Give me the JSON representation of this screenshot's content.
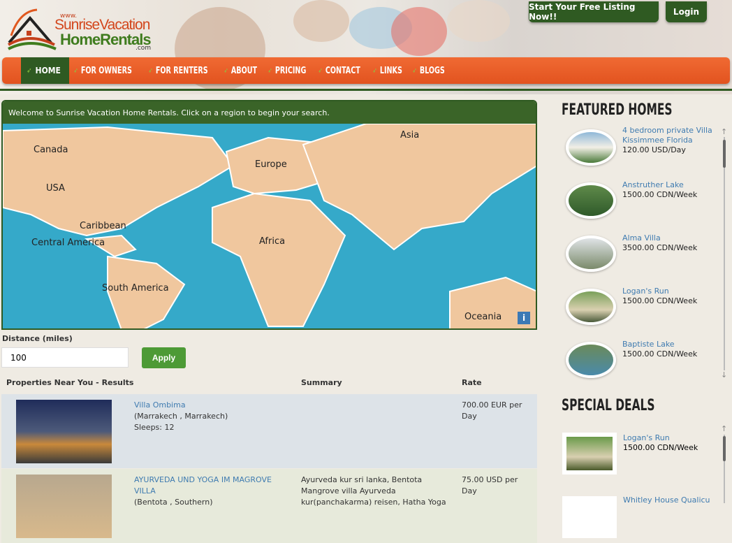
{
  "header": {
    "logo_www": "www.",
    "logo_line1": "SunriseVacation",
    "logo_line2": "HomeRentals",
    "logo_com": ".com",
    "free_listing": "Start Your Free Listing Now!!",
    "login": "Login"
  },
  "nav": [
    "HOME",
    "FOR OWNERS",
    "FOR RENTERS",
    "ABOUT",
    "PRICING",
    "CONTACT",
    "LINKS",
    "BLOGS"
  ],
  "map": {
    "welcome": "Welcome to Sunrise Vacation Home Rentals. Click on a region to begin your search.",
    "regions": [
      "Canada",
      "USA",
      "Caribbean",
      "Central America",
      "South America",
      "Europe",
      "Africa",
      "Asia",
      "Oceania"
    ],
    "info": "i"
  },
  "distance": {
    "label": "Distance (miles)",
    "value": "100",
    "apply": "Apply"
  },
  "results": {
    "headers": [
      "Properties Near You - Results",
      "Summary",
      "Rate"
    ],
    "rows": [
      {
        "name": "Villa Ombima",
        "location": "(Marrakech , Marrakech)",
        "sleeps": "Sleeps: 12",
        "summary": "",
        "rate": "700.00 EUR per Day"
      },
      {
        "name": "AYURVEDA UND YOGA IM MAGROVE VILLA",
        "location": "(Bentota , Southern)",
        "sleeps": "",
        "summary": "Ayurveda kur sri lanka, Bentota Mangrove villa Ayurveda kur(panchakarma) reisen, Hatha Yoga",
        "rate": "75.00 USD per Day"
      }
    ]
  },
  "featured": {
    "title": "FEATURED HOMES",
    "items": [
      {
        "name": "4 bedroom private Villa Kissimmee Florida",
        "price": "120.00 USD/Day"
      },
      {
        "name": "Anstruther Lake",
        "price": "1500.00 CDN/Week"
      },
      {
        "name": "Alma Villa",
        "price": "3500.00 CDN/Week"
      },
      {
        "name": "Logan's Run",
        "price": "1500.00 CDN/Week"
      },
      {
        "name": "Baptiste Lake",
        "price": "1500.00 CDN/Week"
      }
    ]
  },
  "deals": {
    "title": "SPECIAL DEALS",
    "items": [
      {
        "name": "Logan's Run",
        "price": "1500.00 CDN/Week"
      },
      {
        "name": "Whitley House Qualicu",
        "price": ""
      }
    ]
  }
}
